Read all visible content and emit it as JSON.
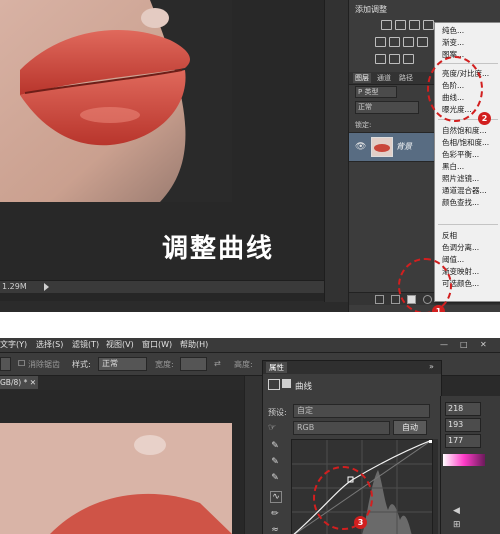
{
  "top_screenshot": {
    "caption": "调整曲线",
    "status_zoom": "1.29M",
    "adjustments_panel_title": "添加调整",
    "layers_tabs": [
      "图层",
      "通道",
      "路径"
    ],
    "kind_label": "P 类型",
    "blend_mode": "正常",
    "lock_label": "锁定:",
    "layer_name": "背景",
    "adjustment_menu": {
      "group1": [
        "纯色...",
        "渐变...",
        "图案..."
      ],
      "group2": [
        "亮度/对比度...",
        "色阶...",
        "曲线...",
        "曝光度..."
      ],
      "group3": [
        "自然饱和度...",
        "色相/饱和度...",
        "色彩平衡...",
        "黑白...",
        "照片滤镜...",
        "通道混合器...",
        "颜色查找..."
      ],
      "group4": [
        "反相",
        "色调分离...",
        "阈值...",
        "渐变映射...",
        "可选颜色..."
      ]
    },
    "annotations": [
      "1",
      "2"
    ]
  },
  "bottom_screenshot": {
    "menubar": [
      "文字(Y)",
      "选择(S)",
      "滤镜(T)",
      "视图(V)",
      "窗口(W)",
      "帮助(H)"
    ],
    "window_controls": [
      "—",
      "□",
      "✕"
    ],
    "options_bar": {
      "antialias_label": "消除锯齿",
      "style_label": "样式:",
      "style_value": "正常",
      "width_label": "宽度:",
      "height_label": "高度:"
    },
    "doc_tab": "GB/8) * ✕",
    "properties": {
      "tab_label": "属性",
      "panel_title": "曲线",
      "preset_label": "预设:",
      "preset_value": "自定",
      "channel_value": "RGB",
      "auto_button": "自动",
      "more_marker": "»"
    },
    "color_values": [
      "218",
      "193",
      "177"
    ],
    "annotation": "3"
  },
  "colors": {
    "annotation_red": "#d21f1f",
    "layer_selected": "#586c82",
    "panel_bg": "#3c3c3c"
  }
}
